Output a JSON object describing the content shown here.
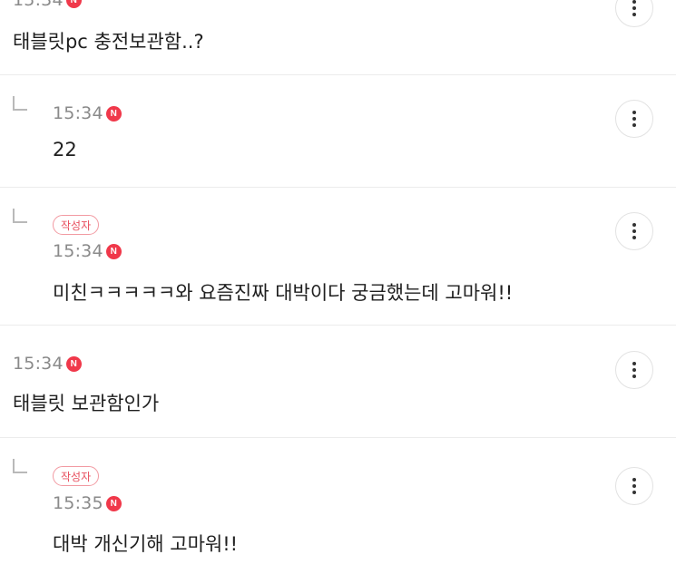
{
  "comments": [
    {
      "time": "15:34",
      "new_badge": "N",
      "text": "태블릿pc 충전보관함..?",
      "is_reply": false,
      "author_badge": null
    },
    {
      "time": "15:34",
      "new_badge": "N",
      "text": "22",
      "is_reply": true,
      "author_badge": null
    },
    {
      "time": "15:34",
      "new_badge": "N",
      "text": "미친ㅋㅋㅋㅋㅋ와 요즘진짜 대박이다 궁금했는데 고마워!!",
      "is_reply": true,
      "author_badge": "작성자"
    },
    {
      "time": "15:34",
      "new_badge": "N",
      "text": "태블릿 보관함인가",
      "is_reply": false,
      "author_badge": null
    },
    {
      "time": "15:35",
      "new_badge": "N",
      "text": "대박 개신기해 고마워!!",
      "is_reply": true,
      "author_badge": "작성자"
    }
  ],
  "colors": {
    "new_badge": "#f0384a",
    "author_badge_text": "#e8505f",
    "author_badge_border": "#f29aa2",
    "time_text": "#8a8a8a",
    "body_text": "#1f1f1f",
    "divider": "#ececec"
  },
  "icons": {
    "reply": "reply-arrow-icon",
    "more": "more-vertical-icon"
  }
}
